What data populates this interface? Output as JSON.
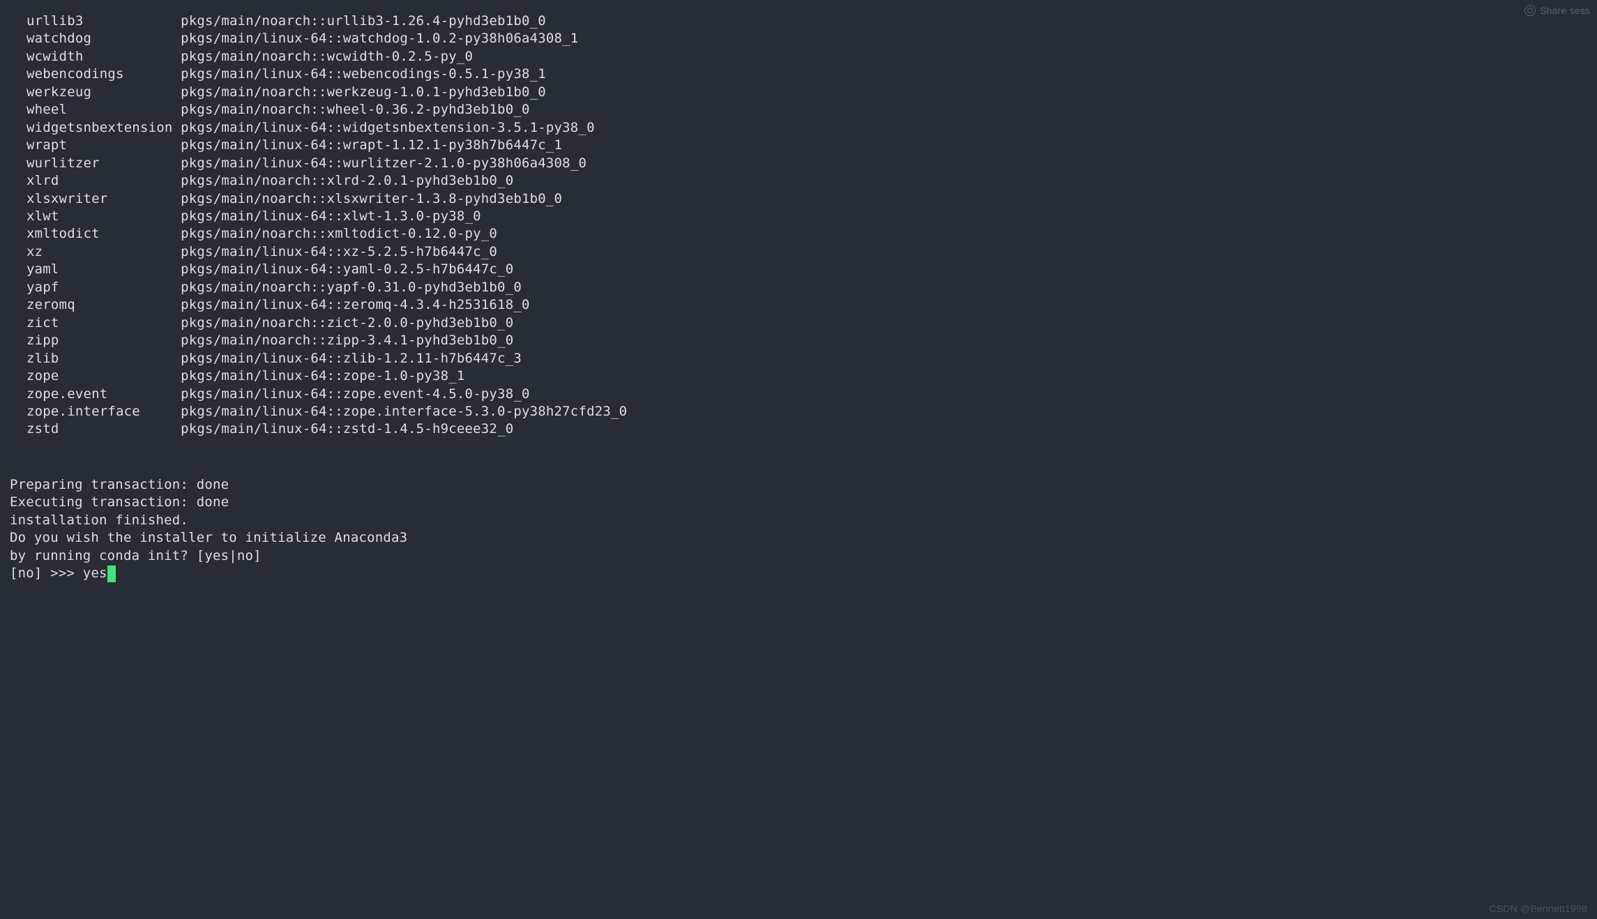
{
  "packages": [
    {
      "name": "urllib3",
      "spec": "pkgs/main/noarch::urllib3-1.26.4-pyhd3eb1b0_0"
    },
    {
      "name": "watchdog",
      "spec": "pkgs/main/linux-64::watchdog-1.0.2-py38h06a4308_1"
    },
    {
      "name": "wcwidth",
      "spec": "pkgs/main/noarch::wcwidth-0.2.5-py_0"
    },
    {
      "name": "webencodings",
      "spec": "pkgs/main/linux-64::webencodings-0.5.1-py38_1"
    },
    {
      "name": "werkzeug",
      "spec": "pkgs/main/noarch::werkzeug-1.0.1-pyhd3eb1b0_0"
    },
    {
      "name": "wheel",
      "spec": "pkgs/main/noarch::wheel-0.36.2-pyhd3eb1b0_0"
    },
    {
      "name": "widgetsnbextension",
      "spec": "pkgs/main/linux-64::widgetsnbextension-3.5.1-py38_0"
    },
    {
      "name": "wrapt",
      "spec": "pkgs/main/linux-64::wrapt-1.12.1-py38h7b6447c_1"
    },
    {
      "name": "wurlitzer",
      "spec": "pkgs/main/linux-64::wurlitzer-2.1.0-py38h06a4308_0"
    },
    {
      "name": "xlrd",
      "spec": "pkgs/main/noarch::xlrd-2.0.1-pyhd3eb1b0_0"
    },
    {
      "name": "xlsxwriter",
      "spec": "pkgs/main/noarch::xlsxwriter-1.3.8-pyhd3eb1b0_0"
    },
    {
      "name": "xlwt",
      "spec": "pkgs/main/linux-64::xlwt-1.3.0-py38_0"
    },
    {
      "name": "xmltodict",
      "spec": "pkgs/main/noarch::xmltodict-0.12.0-py_0"
    },
    {
      "name": "xz",
      "spec": "pkgs/main/linux-64::xz-5.2.5-h7b6447c_0"
    },
    {
      "name": "yaml",
      "spec": "pkgs/main/linux-64::yaml-0.2.5-h7b6447c_0"
    },
    {
      "name": "yapf",
      "spec": "pkgs/main/noarch::yapf-0.31.0-pyhd3eb1b0_0"
    },
    {
      "name": "zeromq",
      "spec": "pkgs/main/linux-64::zeromq-4.3.4-h2531618_0"
    },
    {
      "name": "zict",
      "spec": "pkgs/main/noarch::zict-2.0.0-pyhd3eb1b0_0"
    },
    {
      "name": "zipp",
      "spec": "pkgs/main/noarch::zipp-3.4.1-pyhd3eb1b0_0"
    },
    {
      "name": "zlib",
      "spec": "pkgs/main/linux-64::zlib-1.2.11-h7b6447c_3"
    },
    {
      "name": "zope",
      "spec": "pkgs/main/linux-64::zope-1.0-py38_1"
    },
    {
      "name": "zope.event",
      "spec": "pkgs/main/linux-64::zope.event-4.5.0-py38_0"
    },
    {
      "name": "zope.interface",
      "spec": "pkgs/main/linux-64::zope.interface-5.3.0-py38h27cfd23_0"
    },
    {
      "name": "zstd",
      "spec": "pkgs/main/linux-64::zstd-1.4.5-h9ceee32_0"
    }
  ],
  "status": {
    "preparing": "Preparing transaction: done",
    "executing": "Executing transaction: done",
    "finished": "installation finished.",
    "question1": "Do you wish the installer to initialize Anaconda3",
    "question2": "by running conda init? [yes|no]"
  },
  "prompt": {
    "prefix": "[no] >>> ",
    "input": "yes"
  },
  "share": {
    "label": "Share sess"
  },
  "watermark": "CSDN @Bennett1998",
  "layout": {
    "name_col_width": 19
  }
}
